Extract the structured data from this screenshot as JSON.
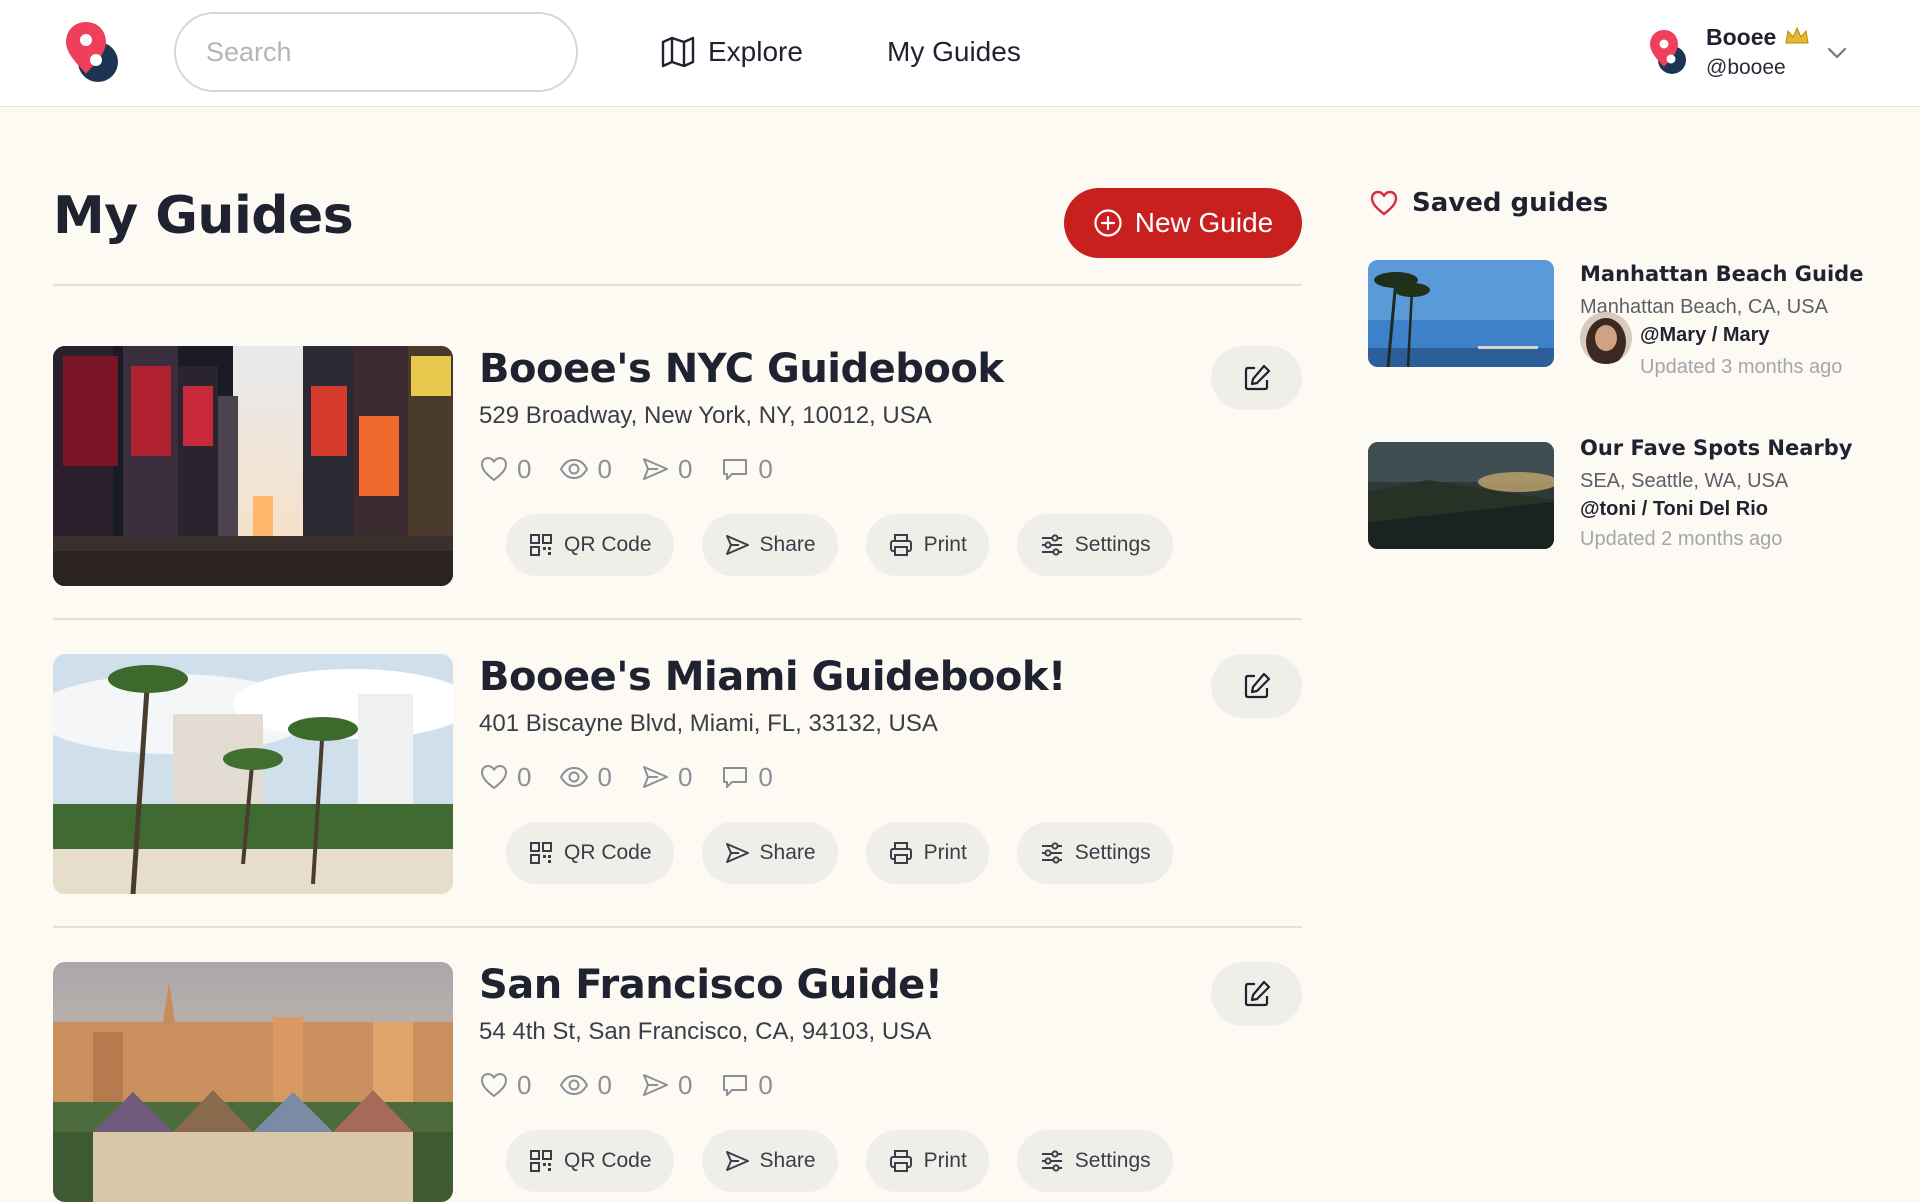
{
  "header": {
    "search_placeholder": "Search",
    "nav": [
      {
        "label": "Explore",
        "icon": "map-icon"
      },
      {
        "label": "My Guides"
      }
    ],
    "user": {
      "name": "Booee",
      "handle": "@booee",
      "badge_icon": "crown-icon"
    }
  },
  "main": {
    "title": "My Guides",
    "new_guide_label": "New Guide",
    "action_labels": {
      "qr": "QR Code",
      "share": "Share",
      "print": "Print",
      "settings": "Settings"
    },
    "guides": [
      {
        "title": "Booee's NYC Guidebook",
        "address": "529 Broadway, New York, NY, 10012, USA",
        "likes": "0",
        "views": "0",
        "shares": "0",
        "comments": "0"
      },
      {
        "title": "Booee's Miami Guidebook!",
        "address": "401 Biscayne Blvd, Miami, FL, 33132, USA",
        "likes": "0",
        "views": "0",
        "shares": "0",
        "comments": "0"
      },
      {
        "title": "San Francisco Guide!",
        "address": "54 4th St, San Francisco, CA, 94103, USA",
        "likes": "0",
        "views": "0",
        "shares": "0",
        "comments": "0"
      }
    ]
  },
  "sidebar": {
    "title": "Saved guides",
    "items": [
      {
        "title": "Manhattan Beach Guide",
        "location": "Manhattan Beach, CA, USA",
        "author": "@Mary / Mary",
        "updated": "Updated 3 months ago"
      },
      {
        "title": "Our Fave Spots Nearby",
        "location": "SEA, Seattle, WA, USA",
        "author": "@toni / Toni Del Rio",
        "updated": "Updated 2 months ago"
      }
    ]
  },
  "colors": {
    "accent": "#c8201f",
    "logo_red": "#ef3f5a",
    "logo_navy": "#1d3552",
    "background": "#fcfaf3"
  }
}
